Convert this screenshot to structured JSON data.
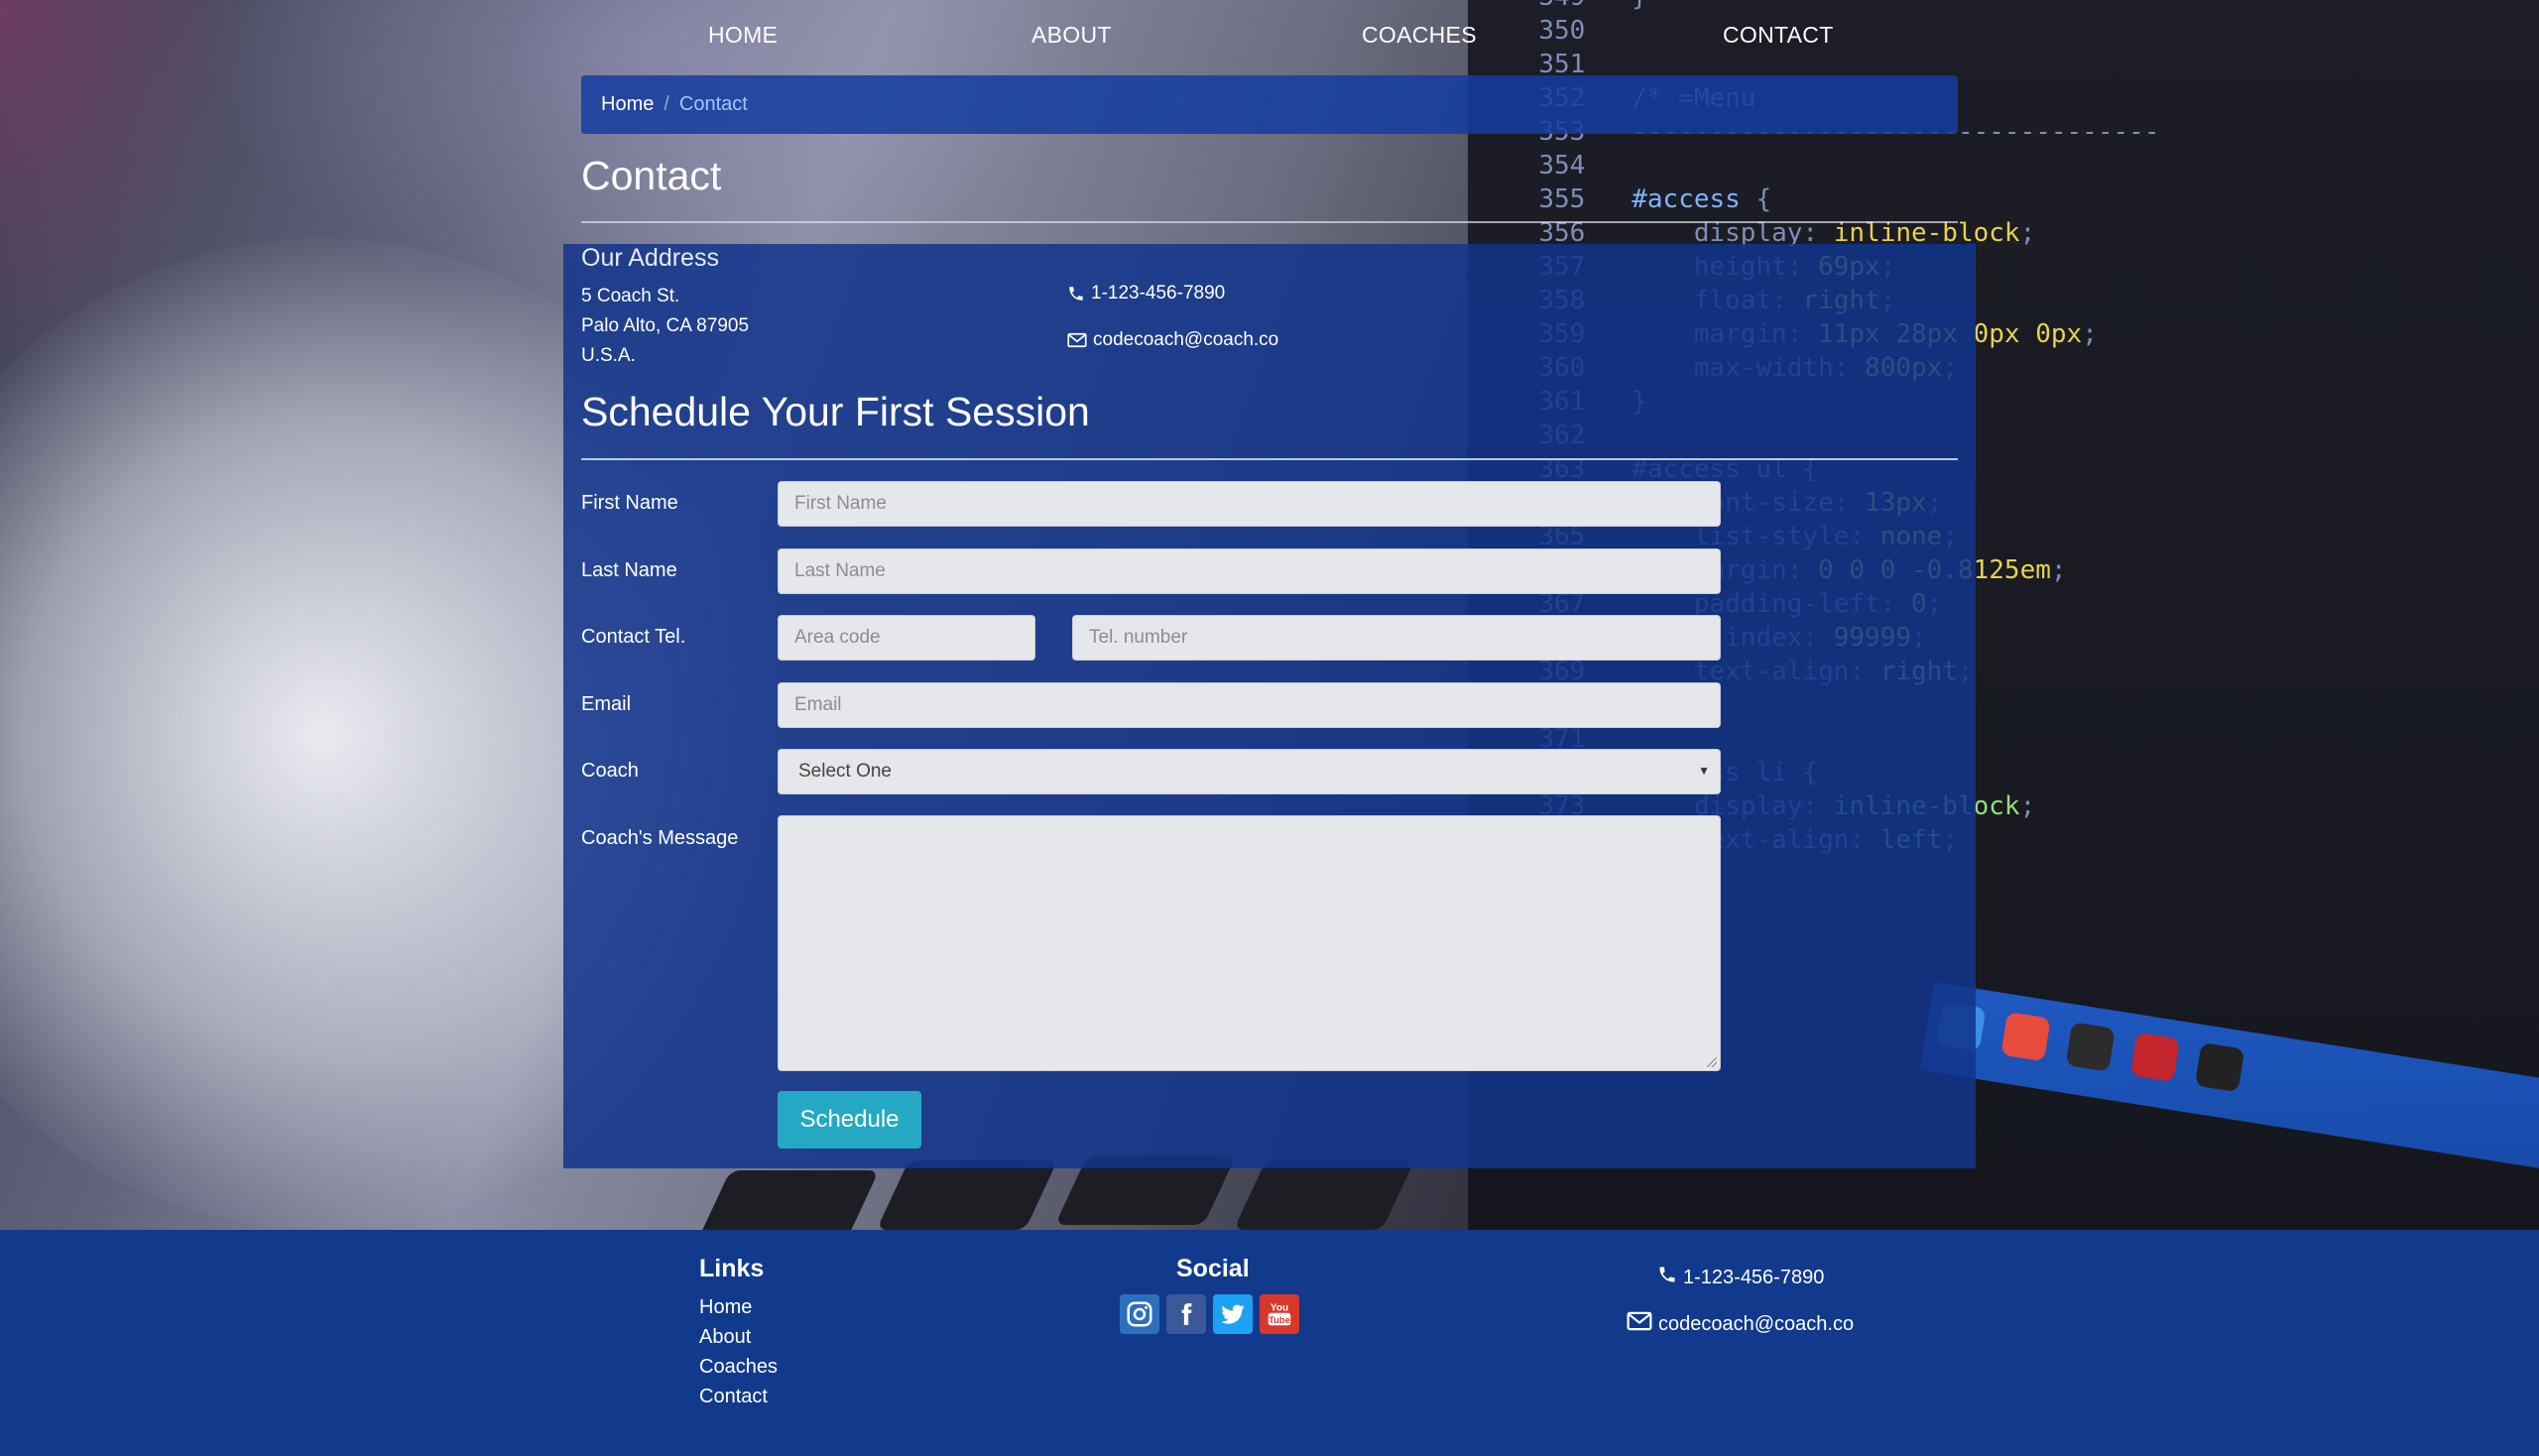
{
  "nav": {
    "items": [
      {
        "label": "HOME"
      },
      {
        "label": "ABOUT"
      },
      {
        "label": "COACHES"
      },
      {
        "label": "CONTACT"
      }
    ]
  },
  "breadcrumb": {
    "home": "Home",
    "separator": "/",
    "current": "Contact"
  },
  "page": {
    "title": "Contact"
  },
  "address": {
    "title": "Our Address",
    "lines": [
      "5 Coach St.",
      "Palo Alto, CA 87905",
      "U.S.A."
    ],
    "phone": "1-123-456-7890",
    "email": "codecoach@coach.co",
    "phone_icon": "phone-icon",
    "email_icon": "envelope-icon"
  },
  "form": {
    "title": "Schedule Your First Session",
    "first_name": {
      "label": "First Name",
      "placeholder": "First Name",
      "value": ""
    },
    "last_name": {
      "label": "Last Name",
      "placeholder": "Last Name",
      "value": ""
    },
    "tel": {
      "label": "Contact Tel.",
      "area_placeholder": "Area code",
      "number_placeholder": "Tel. number"
    },
    "email": {
      "label": "Email",
      "placeholder": "Email",
      "value": ""
    },
    "coach": {
      "label": "Coach",
      "selected": "Select One"
    },
    "message": {
      "label": "Coach's Message",
      "value": ""
    },
    "submit": "Schedule"
  },
  "footer": {
    "links_title": "Links",
    "links": [
      "Home",
      "About",
      "Coaches",
      "Contact"
    ],
    "social_title": "Social",
    "social": [
      {
        "icon": "instagram-icon",
        "color": "#2c6fbf"
      },
      {
        "icon": "facebook-icon",
        "color": "#3b5998"
      },
      {
        "icon": "twitter-icon",
        "color": "#1da1f2"
      },
      {
        "icon": "youtube-icon",
        "color": "#d8382c"
      }
    ],
    "phone": "1-123-456-7890",
    "email": "codecoach@coach.co"
  },
  "colors": {
    "panel": "#12348c",
    "footer": "#123a8c",
    "accent_button": "#25a8c4",
    "breadcrumb_current": "#9ec7ff"
  }
}
